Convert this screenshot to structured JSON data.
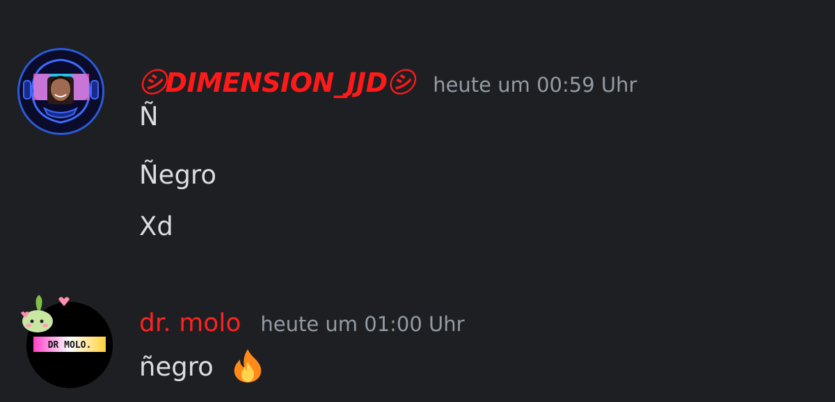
{
  "messages": [
    {
      "username": "㋛DIMENSION_JJD㋛",
      "timestamp": "heute um 00:59 Uhr",
      "lines": [
        "Ñ",
        "Ñegro",
        "Xd"
      ]
    },
    {
      "username": "dr. molo",
      "timestamp": "heute um 01:00 Uhr",
      "avatar_badge_text": "DR MOLO.",
      "lines": [
        "ñegro"
      ],
      "emoji_icon": "fire-emoji-icon"
    }
  ],
  "colors": {
    "background": "#1e1f22",
    "message_text": "#dbdee1",
    "timestamp": "#949ba4",
    "username_red": "#ff1a1a"
  }
}
